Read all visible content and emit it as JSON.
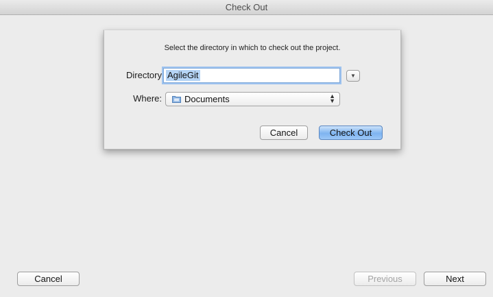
{
  "window": {
    "title": "Check Out"
  },
  "sheet": {
    "message": "Select the directory in which to check out the project.",
    "directory_label": "Directory",
    "directory_value": "AgileGit",
    "where_label": "Where:",
    "where_value": "Documents",
    "cancel_label": "Cancel",
    "checkout_label": "Check Out"
  },
  "footer": {
    "cancel_label": "Cancel",
    "previous_label": "Previous",
    "next_label": "Next"
  },
  "icons": {
    "disclosure": "disclosure-triangle-icon",
    "folder": "folder-icon",
    "popup_arrows": "updown-arrows-icon"
  },
  "colors": {
    "default_button": "#7eb4f0",
    "selection": "#b5d4f5",
    "focus_ring": "#9ec3ef"
  }
}
